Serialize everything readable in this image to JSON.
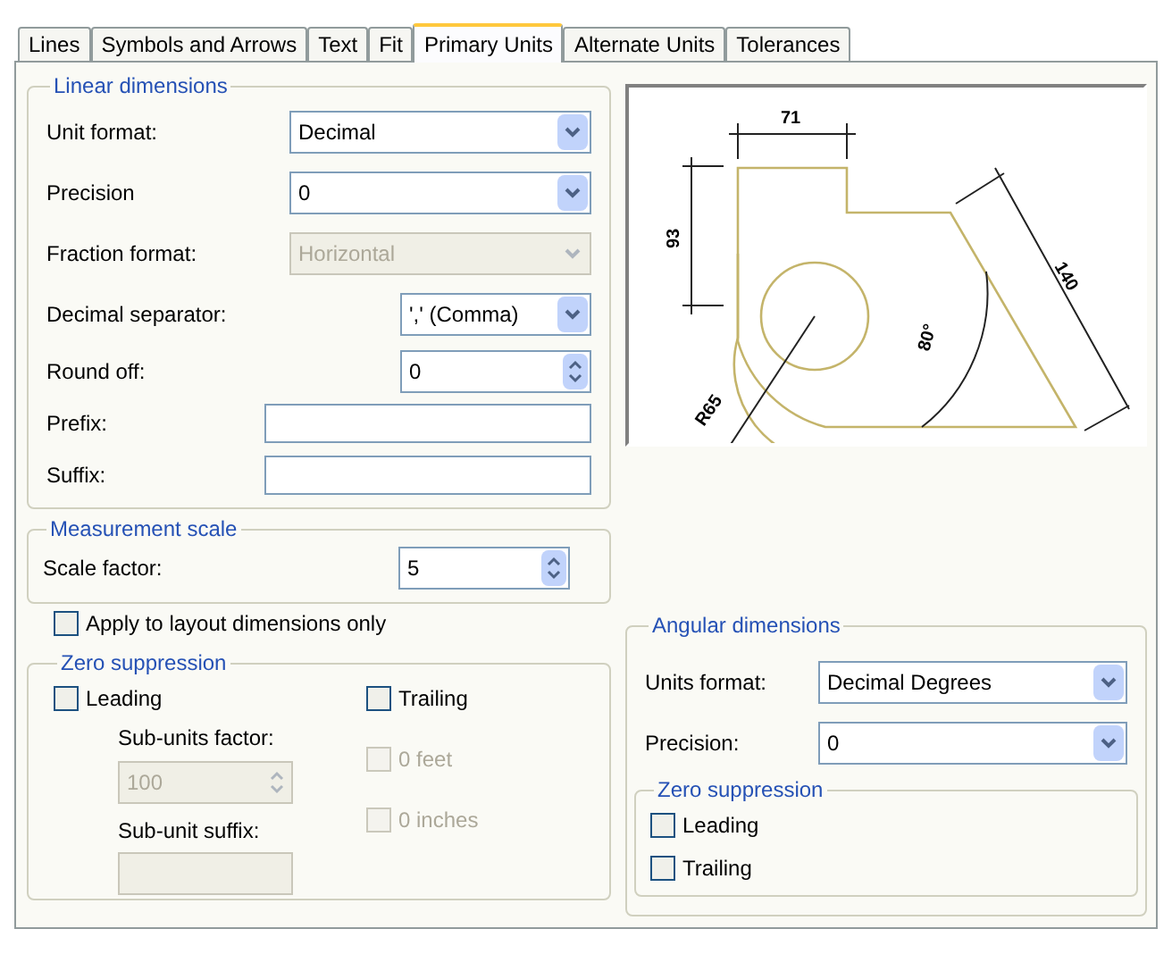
{
  "tabs": [
    {
      "label": "Lines",
      "selected": false
    },
    {
      "label": "Symbols and Arrows",
      "selected": false
    },
    {
      "label": "Text",
      "selected": false
    },
    {
      "label": "Fit",
      "selected": false
    },
    {
      "label": "Primary Units",
      "selected": true
    },
    {
      "label": "Alternate Units",
      "selected": false
    },
    {
      "label": "Tolerances",
      "selected": false
    }
  ],
  "linear_dimensions": {
    "title": "Linear dimensions",
    "fields": [
      {
        "kind": "select",
        "label": "Unit format:",
        "value": "Decimal",
        "disabled": false
      },
      {
        "kind": "select",
        "label": "Precision",
        "value": "0",
        "disabled": false
      },
      {
        "kind": "select",
        "label": "Fraction format:",
        "value": "Horizontal",
        "disabled": true
      },
      {
        "kind": "select",
        "label": "Decimal separator:",
        "value": "',' (Comma)",
        "disabled": false
      },
      {
        "kind": "spin",
        "label": "Round off:",
        "value": "0",
        "disabled": false
      },
      {
        "kind": "text",
        "label": "Prefix:",
        "disabled": false
      },
      {
        "kind": "text",
        "label": "Suffix:",
        "disabled": false
      }
    ]
  },
  "measurement_scale": {
    "title": "Measurement scale",
    "scale_factor": {
      "label": "Scale factor:",
      "value": "5"
    },
    "apply_layout": {
      "label": "Apply to layout dimensions only",
      "checked": false
    }
  },
  "zero_suppression": {
    "title": "Zero suppression",
    "leading": {
      "label": "Leading",
      "checked": false
    },
    "sub_units_factor": {
      "label": "Sub-units factor:",
      "value": "100",
      "disabled": true
    },
    "sub_unit_suffix": {
      "label": "Sub-unit suffix:",
      "disabled": true
    },
    "trailing": {
      "label": "Trailing",
      "checked": false
    },
    "feet": {
      "label": "0 feet",
      "checked": false,
      "disabled": true
    },
    "inches": {
      "label": "0 inches",
      "checked": false,
      "disabled": true
    }
  },
  "preview": {
    "labels": [
      "71",
      "93",
      "140",
      "80°",
      "R65"
    ]
  },
  "angular_dimensions": {
    "title": "Angular dimensions",
    "units_format": {
      "label": "Units format:",
      "value": "Decimal Degrees"
    },
    "precision": {
      "label": "Precision:",
      "value": "0"
    },
    "zero_suppression": {
      "title": "Zero suppression",
      "items": [
        {
          "label": "Leading",
          "checked": false
        },
        {
          "label": "Trailing",
          "checked": false
        }
      ]
    }
  }
}
